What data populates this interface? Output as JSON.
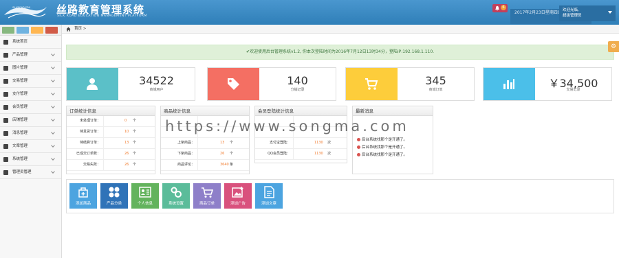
{
  "header": {
    "logo_small_text": "SILKROAD EDU",
    "title_cn": "丝路教育管理系统",
    "title_en": "SILK ROAD EDUCATION MANAGEMENT PLATFORM",
    "notification_count": "6",
    "datetime": "2017年2月23日星期四08:26秒",
    "user_line1": "欢迎光临,",
    "user_line2": "超级管理员"
  },
  "sidebar": {
    "items": [
      {
        "label": "系统首页",
        "icon": "home-icon"
      },
      {
        "label": "产品管理",
        "icon": "monitor-icon"
      },
      {
        "label": "图片管理",
        "icon": "picture-icon"
      },
      {
        "label": "交易管理",
        "icon": "list-icon"
      },
      {
        "label": "支付管理",
        "icon": "card-icon"
      },
      {
        "label": "会员管理",
        "icon": "user-icon"
      },
      {
        "label": "店铺管理",
        "icon": "shop-icon"
      },
      {
        "label": "消息管理",
        "icon": "message-icon"
      },
      {
        "label": "文章管理",
        "icon": "bookmark-icon"
      },
      {
        "label": "系统管理",
        "icon": "gears-icon"
      },
      {
        "label": "管理员管理",
        "icon": "admin-icon"
      }
    ],
    "top_buttons": [
      "green",
      "blue",
      "orange",
      "red"
    ]
  },
  "breadcrumb": {
    "home": "首页",
    "sep": ">"
  },
  "alert": {
    "text": "✔欢迎使用后台管理系统v1.2, 你本次登陆时间为2016年7月12日13时34分，登陆IP:192.168.1.110."
  },
  "stats": [
    {
      "value": "34522",
      "label": "商城用户",
      "color": "#5bc0c8",
      "icon": "user-icon"
    },
    {
      "value": "140",
      "label": "分销记录",
      "color": "#f46f63",
      "icon": "tag-icon"
    },
    {
      "value": "345",
      "label": "商城订单",
      "color": "#fdcd3b",
      "icon": "cart-icon"
    },
    {
      "value": "￥34,500",
      "label": "交易记录",
      "color": "#4bbfe9",
      "icon": "bar-chart-icon"
    }
  ],
  "orders": {
    "title": "订单统计信息",
    "rows": [
      {
        "k": "未处理订单：",
        "v": "0",
        "u": "个"
      },
      {
        "k": "待发货订单：",
        "v": "10",
        "u": "个"
      },
      {
        "k": "待结算订单：",
        "v": "13",
        "u": "个"
      },
      {
        "k": "已成交订单数：",
        "v": "26",
        "u": "个"
      },
      {
        "k": "交易失败：",
        "v": "26",
        "u": "个"
      }
    ]
  },
  "products": {
    "title": "商品统计信息",
    "rows": [
      {
        "k": "",
        "v": "",
        "u": ""
      },
      {
        "k": "",
        "v": "",
        "u": ""
      },
      {
        "k": "上架商品：",
        "v": "13",
        "u": "个"
      },
      {
        "k": "下架商品：",
        "v": "26",
        "u": "个"
      },
      {
        "k": "商品评论：",
        "v": "3640",
        "u": "条"
      }
    ]
  },
  "members": {
    "title": "会员登陆统计信息",
    "rows": [
      {
        "k": "",
        "v": "",
        "u": ""
      },
      {
        "k": "",
        "v": "",
        "u": ""
      },
      {
        "k": "支付宝登陆：",
        "v": "1130",
        "u": "次"
      },
      {
        "k": "QQ会员登陆：",
        "v": "1130",
        "u": "次"
      }
    ]
  },
  "news": {
    "title": "最新消息",
    "items": [
      "后台系统找那个是开通了。",
      "后台系统找那个是开通了。",
      "后台系统找那个是开通了。"
    ]
  },
  "quick": [
    {
      "label": "添加商品",
      "color": "#4ca4e0",
      "icon": "bag-icon"
    },
    {
      "label": "产品分类",
      "color": "#2f73b8",
      "icon": "category-icon"
    },
    {
      "label": "个人信息",
      "color": "#63b35d",
      "icon": "profile-icon"
    },
    {
      "label": "系统设置",
      "color": "#5bbc9a",
      "icon": "settings-icon"
    },
    {
      "label": "商品订单",
      "color": "#8e7fc9",
      "icon": "cart-icon"
    },
    {
      "label": "添加广告",
      "color": "#d9517d",
      "icon": "ad-icon"
    },
    {
      "label": "添加文章",
      "color": "#4ca4e0",
      "icon": "article-icon"
    }
  ],
  "watermark": "https://www.songma.com"
}
